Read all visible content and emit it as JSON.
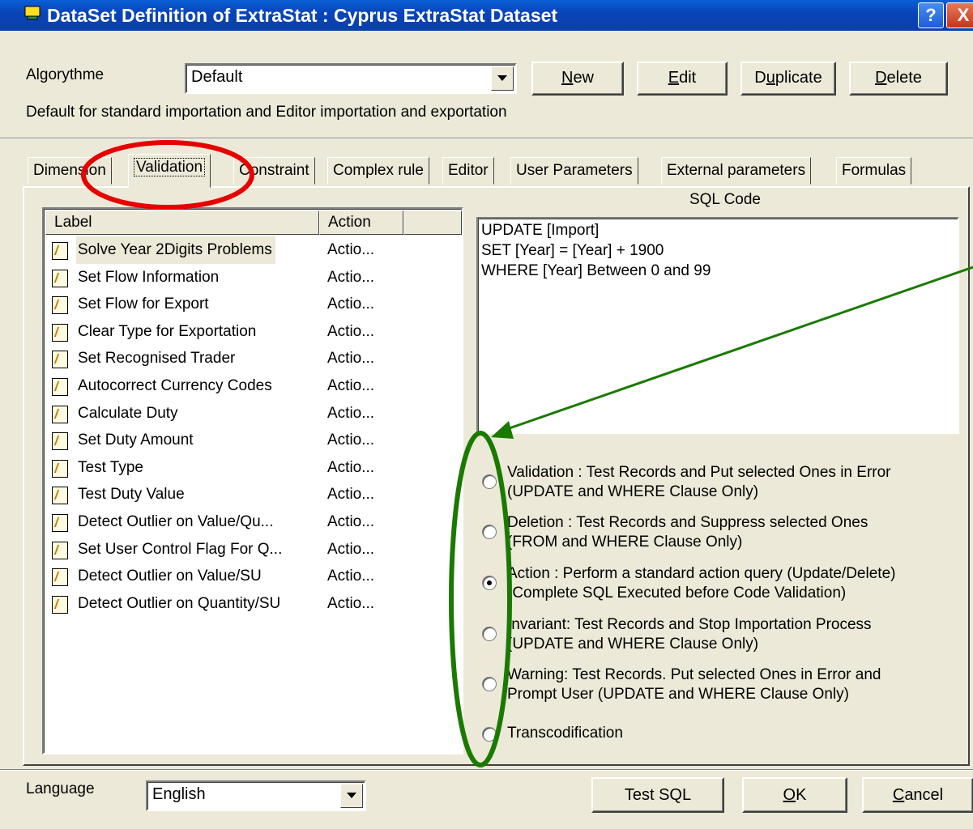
{
  "window": {
    "title": "DataSet Definition of ExtraStat : Cyprus ExtraStat Dataset",
    "help_label": "?",
    "close_label": "X"
  },
  "algorithm": {
    "label": "Algorythme",
    "value": "Default",
    "description": "Default for standard importation and Editor importation and exportation",
    "buttons": {
      "new": {
        "label": "New",
        "underline": "N"
      },
      "edit": {
        "label": "Edit",
        "underline": "E"
      },
      "duplicate": {
        "label": "Duplicate",
        "underline": "u"
      },
      "delete": {
        "label": "Delete",
        "underline": "D"
      }
    }
  },
  "tabs": [
    "Dimension",
    "Validation",
    "Constraint",
    "Complex rule",
    "Editor",
    "User Parameters",
    "External parameters",
    "Formulas"
  ],
  "active_tab": "Validation",
  "list": {
    "headers": {
      "label": "Label",
      "action": "Action"
    },
    "rows": [
      {
        "label": "Solve Year 2Digits Problems",
        "action": "Actio...",
        "selected": true
      },
      {
        "label": "Set Flow Information",
        "action": "Actio..."
      },
      {
        "label": "Set Flow for Export",
        "action": "Actio..."
      },
      {
        "label": "Clear Type for Exportation",
        "action": "Actio..."
      },
      {
        "label": "Set Recognised Trader",
        "action": "Actio..."
      },
      {
        "label": "Autocorrect Currency Codes",
        "action": "Actio..."
      },
      {
        "label": "Calculate Duty",
        "action": "Actio..."
      },
      {
        "label": "Set Duty Amount",
        "action": "Actio..."
      },
      {
        "label": "Test Type",
        "action": "Actio..."
      },
      {
        "label": "Test Duty Value",
        "action": "Actio..."
      },
      {
        "label": "Detect Outlier on Value/Qu...",
        "action": "Actio..."
      },
      {
        "label": "Set User Control Flag For Q...",
        "action": "Actio..."
      },
      {
        "label": "Detect Outlier on Value/SU",
        "action": "Actio..."
      },
      {
        "label": "Detect Outlier on Quantity/SU",
        "action": "Actio..."
      }
    ]
  },
  "sql": {
    "title": "SQL Code",
    "code": "UPDATE [Import]\nSET [Year] = [Year] + 1900\nWHERE [Year] Between 0 and 99"
  },
  "options": [
    {
      "line1": "Validation : Test Records and Put selected Ones in Error",
      "line2": "(UPDATE and WHERE Clause Only)",
      "checked": false
    },
    {
      "line1": "Deletion :  Test Records and Suppress selected Ones",
      "line2": "(FROM and WHERE Clause Only)",
      "checked": false
    },
    {
      "line1": "Action : Perform a standard action query (Update/Delete)",
      "line2": "(Complete SQL Executed before Code Validation)",
      "checked": true
    },
    {
      "line1": "Invariant: Test Records and Stop Importation Process",
      "line2": "(UPDATE and WHERE Clause Only)",
      "checked": false
    },
    {
      "line1": "Warning: Test Records. Put selected Ones in Error and",
      "line2": "Prompt User (UPDATE and WHERE Clause Only)",
      "checked": false
    },
    {
      "line1": "Transcodification",
      "line2": "",
      "checked": false
    }
  ],
  "language": {
    "label": "Language",
    "value": "English"
  },
  "footer_buttons": {
    "test_sql": "Test SQL",
    "ok": {
      "label": "OK",
      "underline": "O"
    },
    "cancel": {
      "label": "Cancel",
      "underline": "C"
    }
  },
  "annotation_colors": {
    "red": "#e60000",
    "green": "#1a7a00"
  }
}
